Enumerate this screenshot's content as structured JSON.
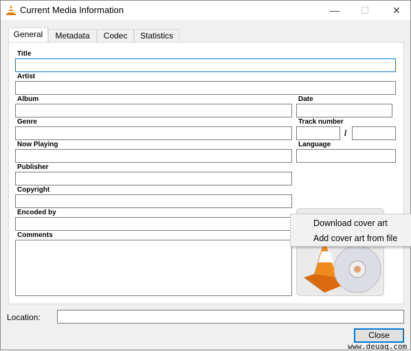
{
  "window": {
    "title": "Current Media Information",
    "minimize": "—",
    "maximize": "☐",
    "close": "✕"
  },
  "tabs": [
    {
      "label": "General",
      "active": true
    },
    {
      "label": "Metadata"
    },
    {
      "label": "Codec"
    },
    {
      "label": "Statistics"
    }
  ],
  "fields": {
    "title": "Title",
    "artist": "Artist",
    "album": "Album",
    "date": "Date",
    "genre": "Genre",
    "track_number": "Track number",
    "track_sep": "/",
    "now_playing": "Now Playing",
    "language": "Language",
    "publisher": "Publisher",
    "copyright": "Copyright",
    "encoded_by": "Encoded by",
    "comments": "Comments"
  },
  "context_menu": [
    "Download cover art",
    "Add cover art from file"
  ],
  "location": {
    "label": "Location:",
    "value": ""
  },
  "close_label": "Close",
  "watermark": "www.deuaq.com",
  "colors": {
    "accent": "#0078d7",
    "cone": "#f08a1c"
  }
}
